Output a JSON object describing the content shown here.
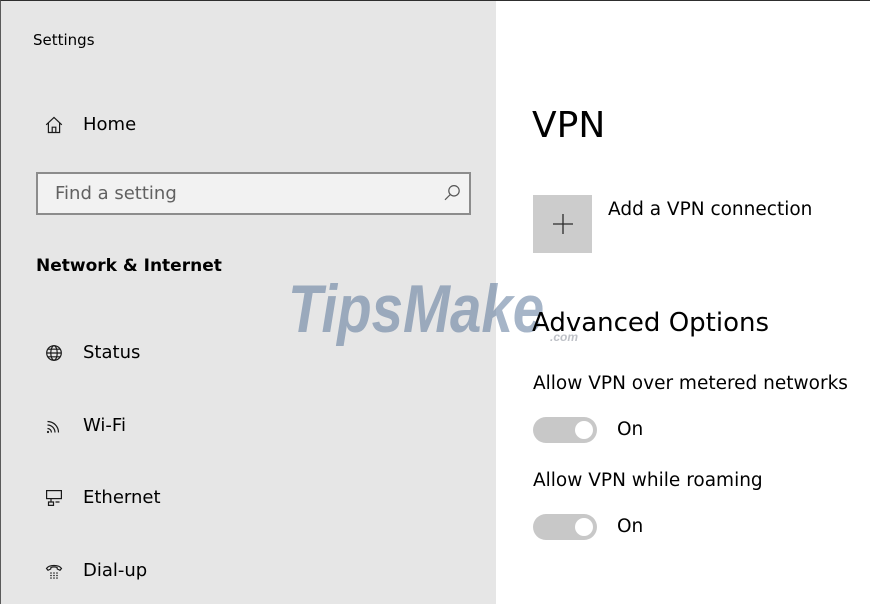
{
  "window": {
    "title": "Settings"
  },
  "sidebar": {
    "home": {
      "label": "Home",
      "icon": "home-icon"
    },
    "search": {
      "placeholder": "Find a setting",
      "value": "",
      "icon": "search-icon"
    },
    "section_title": "Network & Internet",
    "items": [
      {
        "label": "Status",
        "icon": "globe-icon"
      },
      {
        "label": "Wi-Fi",
        "icon": "wifi-icon"
      },
      {
        "label": "Ethernet",
        "icon": "ethernet-icon"
      },
      {
        "label": "Dial-up",
        "icon": "dial-up-icon"
      }
    ]
  },
  "main": {
    "title": "VPN",
    "add_connection": {
      "label": "Add a VPN connection",
      "icon": "plus-icon"
    },
    "advanced": {
      "title": "Advanced Options",
      "options": [
        {
          "label": "Allow VPN over metered networks",
          "state": "On",
          "on": true
        },
        {
          "label": "Allow VPN while roaming",
          "state": "On",
          "on": true
        }
      ]
    }
  },
  "watermark": {
    "text": "TipsMake",
    "suffix": ".com"
  },
  "colors": {
    "sidebar_background": "#e6e6e6",
    "content_background": "#ffffff",
    "add_tile": "#cccccc",
    "toggle_track": "#c8c8c8",
    "toggle_knob": "#ffffff",
    "text": "#000000"
  }
}
